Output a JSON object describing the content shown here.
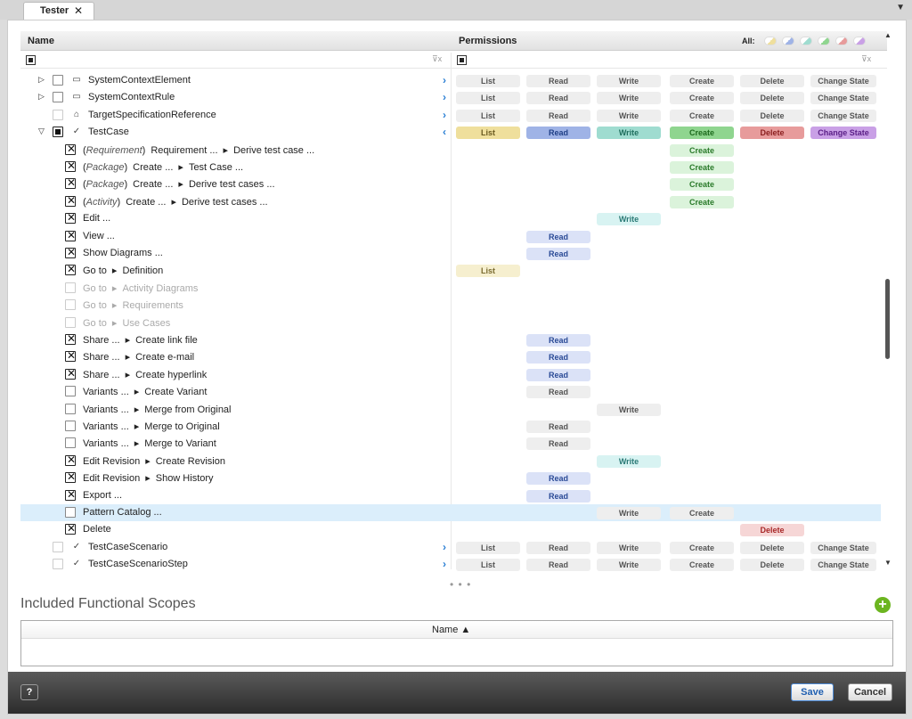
{
  "tab": {
    "title": "Tester",
    "close": "✕",
    "menu": "▼"
  },
  "header": {
    "name_col": "Name",
    "perm_col": "Permissions",
    "all_label": "All:"
  },
  "filter": {
    "icon": "⊽x"
  },
  "colors": {
    "list": "#efdf9c",
    "read": "#9fb3e6",
    "write": "#9fdcd0",
    "create": "#8fd58f",
    "delete": "#e79b9b",
    "change_state": "#c9a0e6",
    "selection": "#dbeefb"
  },
  "rows": [
    {
      "name": "SystemContextElement",
      "expander": "▷",
      "icon": "▭",
      "chevron": "›",
      "p": [
        "List",
        "Read",
        "Write",
        "Create",
        "Delete",
        "Change State"
      ]
    },
    {
      "name": "SystemContextRule",
      "expander": "▷",
      "icon": "▭",
      "chevron": "›",
      "p": [
        "List",
        "Read",
        "Write",
        "Create",
        "Delete",
        "Change State"
      ]
    },
    {
      "name": "TargetSpecificationReference",
      "icon": "⌂",
      "chevron": "›",
      "p": [
        "List",
        "Read",
        "Write",
        "Create",
        "Delete",
        "Change State"
      ]
    },
    {
      "name": "TestCase",
      "expander": "▽",
      "icon": "✓",
      "chevron": "‹",
      "p": [
        "List",
        "Read",
        "Write",
        "Create",
        "Delete",
        "Change State"
      ]
    },
    {
      "open": "(",
      "type": "Requirement",
      "close": ")",
      "name": "Requirement ...",
      "sep": "▸",
      "target": "Derive test case ...",
      "create": "Create"
    },
    {
      "open": "(",
      "type": "Package",
      "close": ")",
      "name": "Create ...",
      "sep": "▸",
      "target": "Test Case ...",
      "create": "Create"
    },
    {
      "open": "(",
      "type": "Package",
      "close": ")",
      "name": "Create ...",
      "sep": "▸",
      "target": "Derive test cases ...",
      "create": "Create"
    },
    {
      "open": "(",
      "type": "Activity",
      "close": ")",
      "name": "Create ...",
      "sep": "▸",
      "target": "Derive test cases ...",
      "create": "Create"
    },
    {
      "name": "Edit ...",
      "write": "Write"
    },
    {
      "name": "View ...",
      "read": "Read"
    },
    {
      "name": "Show Diagrams ...",
      "read": "Read"
    },
    {
      "name": "Go to",
      "sep": "▸",
      "target": "Definition",
      "list": "List"
    },
    {
      "name": "Go to",
      "sep": "▸",
      "target": "Activity Diagrams"
    },
    {
      "name": "Go to",
      "sep": "▸",
      "target": "Requirements"
    },
    {
      "name": "Go to",
      "sep": "▸",
      "target": "Use Cases"
    },
    {
      "name": "Share ...",
      "sep": "▸",
      "target": "Create link file",
      "read": "Read"
    },
    {
      "name": "Share ...",
      "sep": "▸",
      "target": "Create e-mail",
      "read": "Read"
    },
    {
      "name": "Share ...",
      "sep": "▸",
      "target": "Create hyperlink",
      "read": "Read"
    },
    {
      "name": "Variants ...",
      "sep": "▸",
      "target": "Create Variant",
      "read": "Read"
    },
    {
      "name": "Variants ...",
      "sep": "▸",
      "target": "Merge from Original",
      "write": "Write"
    },
    {
      "name": "Variants ...",
      "sep": "▸",
      "target": "Merge to Original",
      "read": "Read"
    },
    {
      "name": "Variants ...",
      "sep": "▸",
      "target": "Merge to Variant",
      "read": "Read"
    },
    {
      "name": "Edit Revision",
      "sep": "▸",
      "target": "Create Revision",
      "write": "Write"
    },
    {
      "name": "Edit Revision",
      "sep": "▸",
      "target": "Show History",
      "read": "Read"
    },
    {
      "name": "Export ...",
      "read": "Read"
    },
    {
      "name": "Pattern Catalog ...",
      "write": "Write",
      "create": "Create"
    },
    {
      "name": "Delete",
      "delete": "Delete"
    },
    {
      "name": "TestCaseScenario",
      "icon": "✓",
      "chevron": "›",
      "p": [
        "List",
        "Read",
        "Write",
        "Create",
        "Delete",
        "Change State"
      ]
    },
    {
      "name": "TestCaseScenarioStep",
      "icon": "✓",
      "chevron": "›",
      "p": [
        "List",
        "Read",
        "Write",
        "Create",
        "Delete",
        "Change State"
      ]
    }
  ],
  "more": "• • •",
  "scopes": {
    "title": "Included Functional Scopes",
    "add": "+",
    "name_col": "Name ▲"
  },
  "footer": {
    "help": "?",
    "save": "Save",
    "cancel": "Cancel"
  }
}
